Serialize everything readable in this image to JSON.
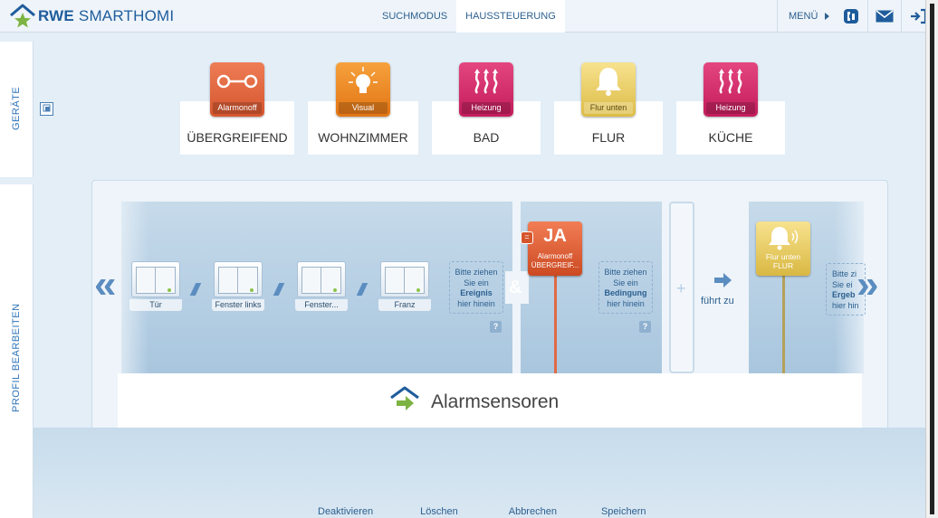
{
  "header": {
    "logo_brand": "RWE",
    "logo_product": "SMARTHOMI",
    "nav": [
      {
        "label": "SUCHMODUS",
        "active": false
      },
      {
        "label": "HAUSSTEUERUNG",
        "active": true
      }
    ],
    "menu_label": "MENÜ",
    "icons": [
      "phone-icon",
      "mail-icon",
      "logout-icon"
    ]
  },
  "sidebar": {
    "tab_devices": "GERÄTE",
    "tab_profile": "PROFIL BEARBEITEN"
  },
  "rooms": [
    {
      "name": "ÜBERGREIFEND",
      "tile_label": "Alarmonoff",
      "color": "#d5552d",
      "icon": "alarm-switch-icon"
    },
    {
      "name": "WOHNZIMMER",
      "tile_label": "Visual",
      "color": "#e27514",
      "icon": "light-bulb-icon"
    },
    {
      "name": "BAD",
      "tile_label": "Heizung",
      "color": "#c31c5c",
      "icon": "heating-icon"
    },
    {
      "name": "FLUR",
      "tile_label": "Flur unten",
      "color": "#dcbc47",
      "icon": "bell-icon"
    },
    {
      "name": "KÜCHE",
      "tile_label": "Heizung",
      "color": "#c31c5c",
      "icon": "heating-icon"
    }
  ],
  "rule": {
    "devices": [
      {
        "label": "Tür"
      },
      {
        "label": "Fenster links"
      },
      {
        "label": "Fenster..."
      },
      {
        "label": "Franz"
      }
    ],
    "event_drop": {
      "line1": "Bitte ziehen",
      "line2": "Sie ein",
      "strong": "Ereignis",
      "line4": "hier hinein"
    },
    "help": "?",
    "and_symbol": "&",
    "condition": {
      "badge": "=",
      "value": "JA",
      "line1": "Alarmonoff",
      "line2": "ÜBERGREIF..."
    },
    "condition_drop": {
      "line1": "Bitte ziehen",
      "line2": "Sie ein",
      "strong": "Bedingung",
      "line4": "hier hinein"
    },
    "plus": "+",
    "leads_to": "führt zu",
    "action": {
      "line1": "Flur unten",
      "line2": "FLUR"
    },
    "action_drop": {
      "line1": "Bitte zi",
      "line2": "Sie ei",
      "strong": "Ergeb",
      "line4": "hier hin"
    }
  },
  "profile_title": "Alarmsensoren",
  "footer": [
    "Deaktivieren",
    "Löschen",
    "Abbrechen",
    "Speichern"
  ]
}
